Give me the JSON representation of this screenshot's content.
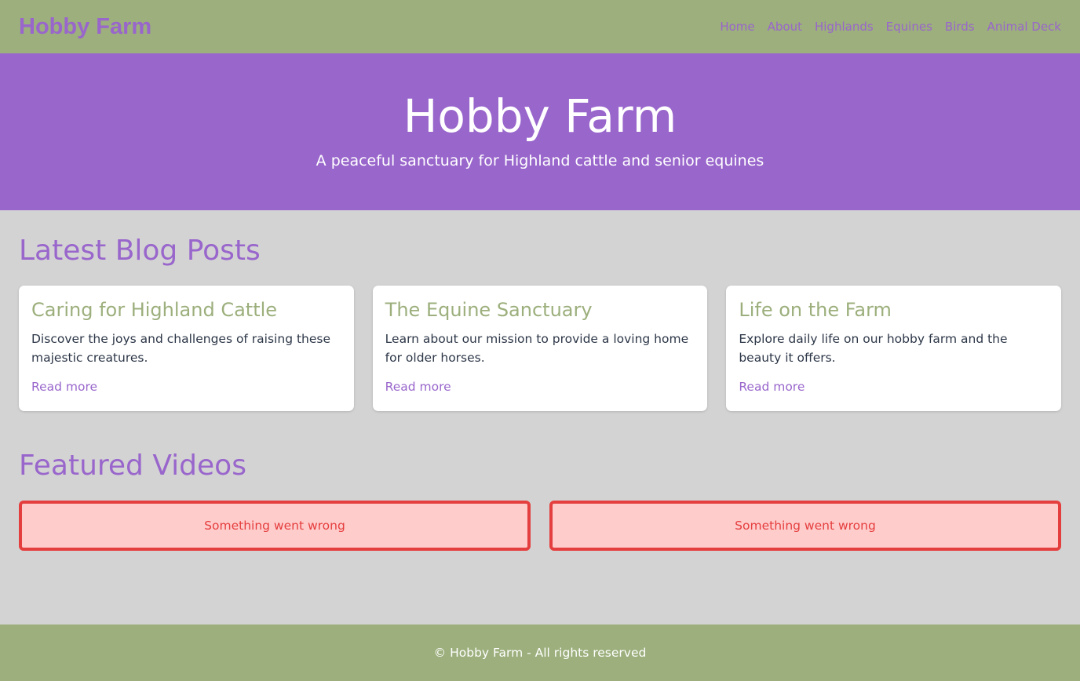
{
  "nav": {
    "brand": "Hobby Farm",
    "links": [
      "Home",
      "About",
      "Highlands",
      "Equines",
      "Birds",
      "Animal Deck"
    ]
  },
  "hero": {
    "title": "Hobby Farm",
    "subtitle": "A peaceful sanctuary for Highland cattle and senior equines"
  },
  "blog": {
    "title": "Latest Blog Posts",
    "posts": [
      {
        "title": "Caring for Highland Cattle",
        "excerpt": "Discover the joys and challenges of raising these majestic creatures.",
        "link": "Read more"
      },
      {
        "title": "The Equine Sanctuary",
        "excerpt": "Learn about our mission to provide a loving home for older horses.",
        "link": "Read more"
      },
      {
        "title": "Life on the Farm",
        "excerpt": "Explore daily life on our hobby farm and the beauty it offers.",
        "link": "Read more"
      }
    ]
  },
  "videos": {
    "title": "Featured Videos",
    "errors": [
      "Something went wrong",
      "Something went wrong"
    ]
  },
  "footer": {
    "text": "© Hobby Farm - All rights reserved"
  },
  "colors": {
    "green": "#9caf7c",
    "purple": "#9966cc",
    "error_red": "#e53e3e",
    "error_bg": "#ffcccc"
  }
}
